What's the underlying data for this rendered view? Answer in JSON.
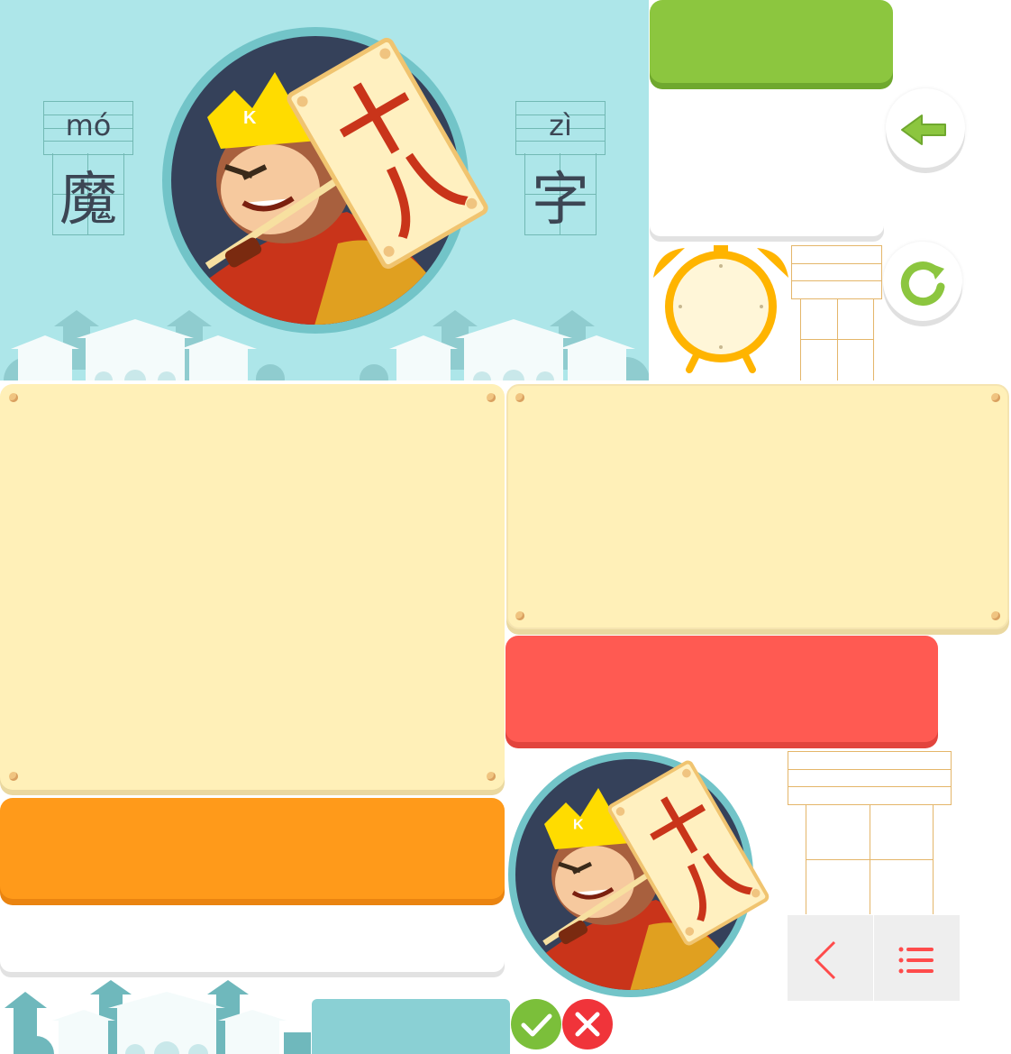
{
  "banner": {
    "pinyin_left": "mó",
    "hanzi_left": "魔",
    "pinyin_right": "zì",
    "hanzi_right": "字",
    "crown_letter": "K",
    "sign_text": "十八"
  },
  "mascot_small": {
    "crown_letter": "K",
    "sign_text": "十八"
  },
  "icons": {
    "back": "back-arrow-icon",
    "reload": "reload-icon",
    "alarm": "alarm-clock-icon",
    "prev": "chevron-left-icon",
    "menu": "list-menu-icon",
    "correct": "check-icon",
    "wrong": "cross-icon"
  },
  "colors": {
    "banner_bg": "#ade6e9",
    "green": "#8cc63f",
    "orange": "#ff9a1a",
    "red": "#ff5a52",
    "teal": "#8ad0d4",
    "panel": "#fff0b8",
    "clock": "#ffb400"
  }
}
